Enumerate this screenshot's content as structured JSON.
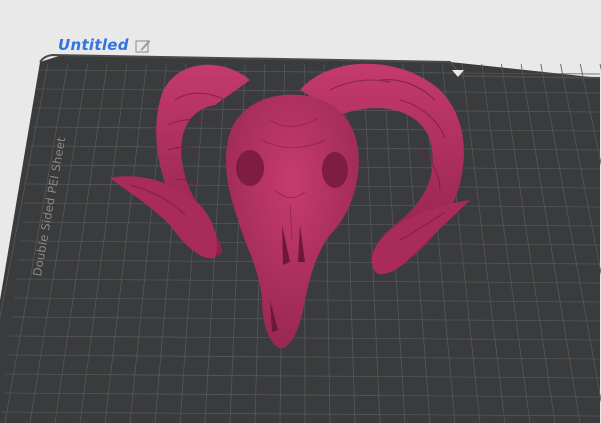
{
  "project": {
    "title": "Untitled",
    "edit_icon": "edit-pencil-icon"
  },
  "build_plate": {
    "label": "Double Sided PEI Sheet"
  },
  "model": {
    "name": "ram-skull-model",
    "color": "#b53061"
  },
  "colors": {
    "background": "#e9e9e9",
    "plate": "#3a3b3c",
    "grid": "#565758",
    "title_accent": "#2f74e0"
  }
}
